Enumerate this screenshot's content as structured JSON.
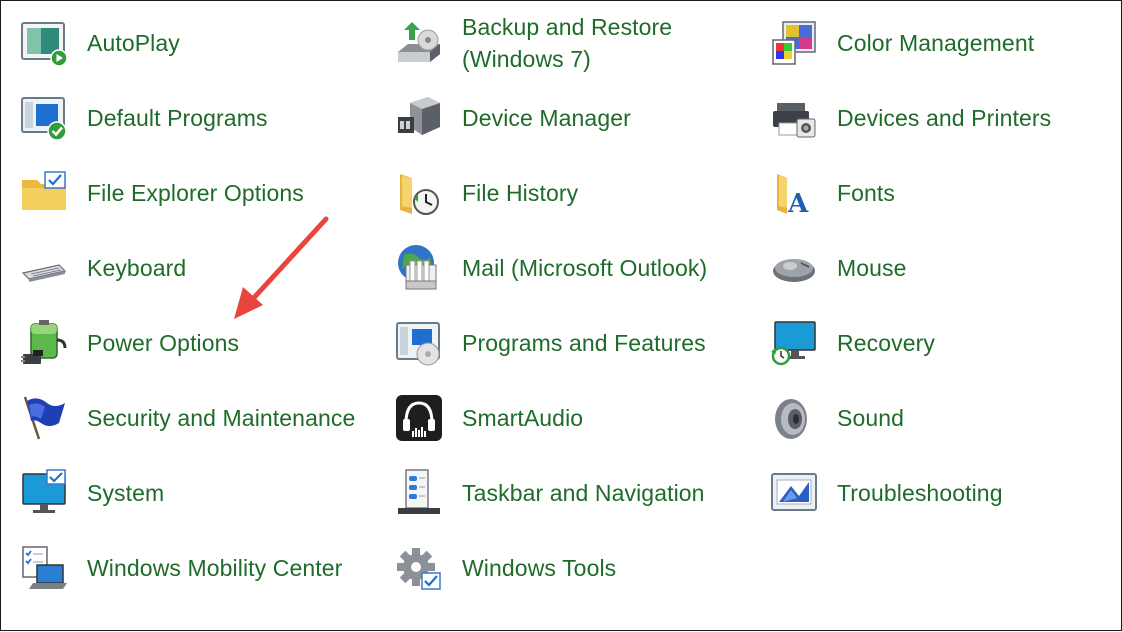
{
  "items": [
    {
      "label": "AutoPlay",
      "icon": "autoplay-icon"
    },
    {
      "label": "Backup and Restore\n(Windows 7)",
      "icon": "backup-restore-icon"
    },
    {
      "label": "Color Management",
      "icon": "color-management-icon"
    },
    {
      "label": "Default Programs",
      "icon": "default-programs-icon"
    },
    {
      "label": "Device Manager",
      "icon": "device-manager-icon"
    },
    {
      "label": "Devices and Printers",
      "icon": "devices-printers-icon"
    },
    {
      "label": "File Explorer Options",
      "icon": "file-explorer-options-icon"
    },
    {
      "label": "File History",
      "icon": "file-history-icon"
    },
    {
      "label": "Fonts",
      "icon": "fonts-icon"
    },
    {
      "label": "Keyboard",
      "icon": "keyboard-icon"
    },
    {
      "label": "Mail (Microsoft Outlook)",
      "icon": "mail-icon"
    },
    {
      "label": "Mouse",
      "icon": "mouse-icon"
    },
    {
      "label": "Power Options",
      "icon": "power-options-icon"
    },
    {
      "label": "Programs and Features",
      "icon": "programs-features-icon"
    },
    {
      "label": "Recovery",
      "icon": "recovery-icon"
    },
    {
      "label": "Security and Maintenance",
      "icon": "security-maintenance-icon"
    },
    {
      "label": "SmartAudio",
      "icon": "smartaudio-icon"
    },
    {
      "label": "Sound",
      "icon": "sound-icon"
    },
    {
      "label": "System",
      "icon": "system-icon"
    },
    {
      "label": "Taskbar and Navigation",
      "icon": "taskbar-navigation-icon"
    },
    {
      "label": "Troubleshooting",
      "icon": "troubleshooting-icon"
    },
    {
      "label": "Windows Mobility Center",
      "icon": "mobility-center-icon"
    },
    {
      "label": "Windows Tools",
      "icon": "windows-tools-icon"
    }
  ],
  "colors": {
    "label": "#1e6b2a",
    "annotation_arrow": "#e8453c"
  }
}
